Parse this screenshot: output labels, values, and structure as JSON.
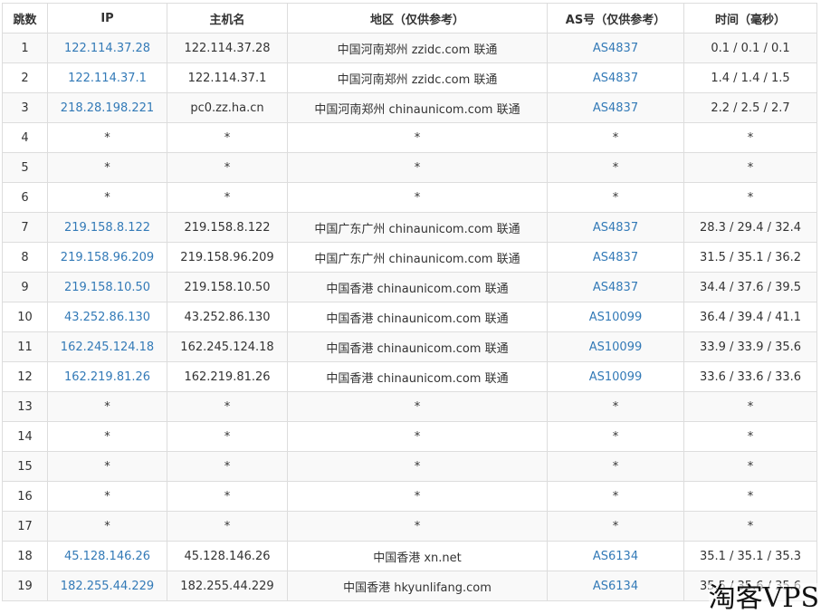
{
  "table": {
    "headers": [
      "跳数",
      "IP",
      "主机名",
      "地区（仅供参考）",
      "AS号（仅供参考）",
      "时间（毫秒）"
    ],
    "rows": [
      {
        "hop": "1",
        "ip": "122.114.37.28",
        "host": "122.114.37.28",
        "region": "中国河南郑州 zzidc.com 联通",
        "as": "AS4837",
        "time": "0.1 / 0.1 / 0.1"
      },
      {
        "hop": "2",
        "ip": "122.114.37.1",
        "host": "122.114.37.1",
        "region": "中国河南郑州 zzidc.com 联通",
        "as": "AS4837",
        "time": "1.4 / 1.4 / 1.5"
      },
      {
        "hop": "3",
        "ip": "218.28.198.221",
        "host": "pc0.zz.ha.cn",
        "region": "中国河南郑州 chinaunicom.com 联通",
        "as": "AS4837",
        "time": "2.2 / 2.5 / 2.7"
      },
      {
        "hop": "4",
        "ip": "*",
        "host": "*",
        "region": "*",
        "as": "*",
        "time": "*"
      },
      {
        "hop": "5",
        "ip": "*",
        "host": "*",
        "region": "*",
        "as": "*",
        "time": "*"
      },
      {
        "hop": "6",
        "ip": "*",
        "host": "*",
        "region": "*",
        "as": "*",
        "time": "*"
      },
      {
        "hop": "7",
        "ip": "219.158.8.122",
        "host": "219.158.8.122",
        "region": "中国广东广州 chinaunicom.com 联通",
        "as": "AS4837",
        "time": "28.3 / 29.4 / 32.4"
      },
      {
        "hop": "8",
        "ip": "219.158.96.209",
        "host": "219.158.96.209",
        "region": "中国广东广州 chinaunicom.com 联通",
        "as": "AS4837",
        "time": "31.5 / 35.1 / 36.2"
      },
      {
        "hop": "9",
        "ip": "219.158.10.50",
        "host": "219.158.10.50",
        "region": "中国香港 chinaunicom.com 联通",
        "as": "AS4837",
        "time": "34.4 / 37.6 / 39.5"
      },
      {
        "hop": "10",
        "ip": "43.252.86.130",
        "host": "43.252.86.130",
        "region": "中国香港 chinaunicom.com 联通",
        "as": "AS10099",
        "time": "36.4 / 39.4 / 41.1"
      },
      {
        "hop": "11",
        "ip": "162.245.124.18",
        "host": "162.245.124.18",
        "region": "中国香港 chinaunicom.com 联通",
        "as": "AS10099",
        "time": "33.9 / 33.9 / 35.6"
      },
      {
        "hop": "12",
        "ip": "162.219.81.26",
        "host": "162.219.81.26",
        "region": "中国香港 chinaunicom.com 联通",
        "as": "AS10099",
        "time": "33.6 / 33.6 / 33.6"
      },
      {
        "hop": "13",
        "ip": "*",
        "host": "*",
        "region": "*",
        "as": "*",
        "time": "*"
      },
      {
        "hop": "14",
        "ip": "*",
        "host": "*",
        "region": "*",
        "as": "*",
        "time": "*"
      },
      {
        "hop": "15",
        "ip": "*",
        "host": "*",
        "region": "*",
        "as": "*",
        "time": "*"
      },
      {
        "hop": "16",
        "ip": "*",
        "host": "*",
        "region": "*",
        "as": "*",
        "time": "*"
      },
      {
        "hop": "17",
        "ip": "*",
        "host": "*",
        "region": "*",
        "as": "*",
        "time": "*"
      },
      {
        "hop": "18",
        "ip": "45.128.146.26",
        "host": "45.128.146.26",
        "region": "中国香港 xn.net",
        "as": "AS6134",
        "time": "35.1 / 35.1 / 35.3"
      },
      {
        "hop": "19",
        "ip": "182.255.44.229",
        "host": "182.255.44.229",
        "region": "中国香港 hkyunlifang.com",
        "as": "AS6134",
        "time": "35.5 / 35.6 / 35.6"
      }
    ]
  },
  "watermark": "淘客VPS",
  "colors": {
    "link": "#337ab7",
    "border": "#dddddd",
    "row_stripe": "#f9f9f9",
    "text": "#333333"
  }
}
